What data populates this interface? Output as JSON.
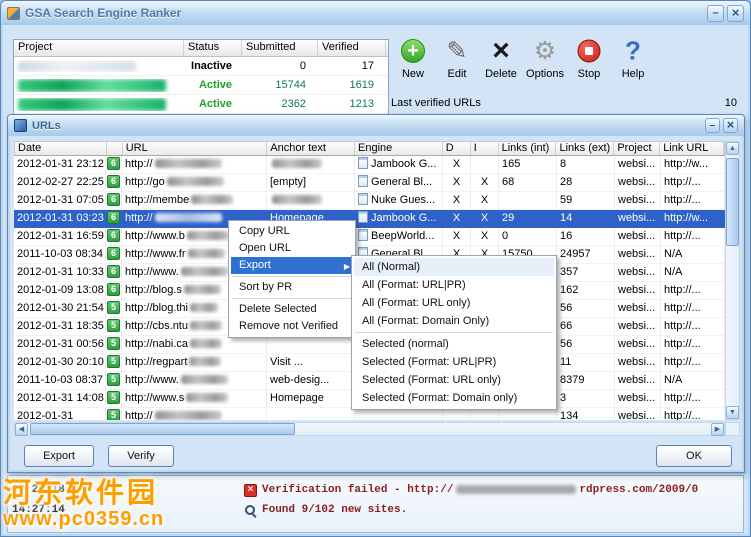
{
  "colors": {
    "selection": "#2e62c8",
    "menu_highlight": "#2f71d0",
    "active_status": "#1da321",
    "active_numbers": "#0c7a5a",
    "log_text": "#8b1e1e",
    "watermark_orange": "#ff9c00",
    "badge_green": "#2f9e44"
  },
  "main_window": {
    "title": "GSA Search Engine Ranker"
  },
  "projects_panel": {
    "columns": [
      "Project",
      "Status",
      "Submitted",
      "Verified"
    ],
    "rows": [
      {
        "status": "Inactive",
        "submitted": "0",
        "verified": "17",
        "active": false
      },
      {
        "status": "Active",
        "submitted": "15744",
        "verified": "1619",
        "active": true
      },
      {
        "status": "Active",
        "submitted": "2362",
        "verified": "1213",
        "active": true
      }
    ]
  },
  "toolbar": {
    "items": [
      {
        "label": "New",
        "icon": "new-icon"
      },
      {
        "label": "Edit",
        "icon": "edit-icon"
      },
      {
        "label": "Delete",
        "icon": "delete-icon"
      },
      {
        "label": "Options",
        "icon": "options-icon"
      },
      {
        "label": "Stop",
        "icon": "stop-icon"
      },
      {
        "label": "Help",
        "icon": "help-icon"
      }
    ],
    "last_verified_label": "Last verified URLs",
    "last_verified_value": "10"
  },
  "urls_window": {
    "title": "URLs",
    "columns": [
      "Date",
      "",
      "URL",
      "Anchor text",
      "Engine",
      "D",
      "I",
      "Links (int)",
      "Links (ext)",
      "Project",
      "Link URL"
    ],
    "export_button": "Export",
    "verify_button": "Verify",
    "ok_button": "OK",
    "rows": [
      {
        "date": "2012-01-31 23:12",
        "pr": "6",
        "url_prefix": "http://",
        "url_blur": true,
        "anchor": "",
        "anchor_blur": true,
        "engine": "Jambook G...",
        "d": "X",
        "i": "",
        "links_int": "165",
        "links_ext": "8",
        "project": "websi...",
        "link_url": "http://w...",
        "selected": false
      },
      {
        "date": "2012-02-27 22:25",
        "pr": "6",
        "url_prefix": "http://go",
        "url_blur": true,
        "anchor": "[empty]",
        "anchor_blur": false,
        "engine": "General Bl...",
        "d": "X",
        "i": "X",
        "links_int": "68",
        "links_ext": "28",
        "project": "websi...",
        "link_url": "http://...",
        "selected": false
      },
      {
        "date": "2012-01-31 07:05",
        "pr": "6",
        "url_prefix": "http://membe",
        "url_blur": true,
        "anchor": "",
        "anchor_blur": true,
        "engine": "Nuke Gues...",
        "d": "X",
        "i": "X",
        "links_int": "",
        "links_ext": "59",
        "project": "websi...",
        "link_url": "http://...",
        "selected": false
      },
      {
        "date": "2012-01-31 03:23",
        "pr": "6",
        "url_prefix": "http://",
        "url_blur": true,
        "anchor": "Homepage",
        "anchor_blur": false,
        "engine": "Jambook G...",
        "d": "X",
        "i": "X",
        "links_int": "29",
        "links_ext": "14",
        "project": "websi...",
        "link_url": "http://w...",
        "selected": true
      },
      {
        "date": "2012-01-31 16:59",
        "pr": "6",
        "url_prefix": "http://www.b",
        "url_blur": true,
        "anchor": "",
        "anchor_blur": false,
        "engine": "BeepWorld...",
        "d": "X",
        "i": "X",
        "links_int": "0",
        "links_ext": "16",
        "project": "websi...",
        "link_url": "http://...",
        "selected": false
      },
      {
        "date": "2011-10-03 08:34",
        "pr": "6",
        "url_prefix": "http://www.fr",
        "url_blur": true,
        "anchor": "",
        "anchor_blur": false,
        "engine": "General Bl...",
        "d": "X",
        "i": "X",
        "links_int": "15750",
        "links_ext": "24957",
        "project": "websi...",
        "link_url": "N/A",
        "selected": false
      },
      {
        "date": "2012-01-31 10:33",
        "pr": "6",
        "url_prefix": "http://www.",
        "url_blur": true,
        "anchor": "",
        "anchor_blur": false,
        "engine": "",
        "d": "",
        "i": "",
        "links_int": "",
        "links_ext": "357",
        "project": "websi...",
        "link_url": "N/A",
        "selected": false
      },
      {
        "date": "2012-01-09 13:08",
        "pr": "6",
        "url_prefix": "http://blog.s",
        "url_blur": true,
        "anchor": "",
        "anchor_blur": false,
        "engine": "",
        "d": "",
        "i": "",
        "links_int": "",
        "links_ext": "162",
        "project": "websi...",
        "link_url": "http://...",
        "selected": false
      },
      {
        "date": "2012-01-30 21:54",
        "pr": "5",
        "url_prefix": "http://blog.thi",
        "url_blur": true,
        "anchor": "",
        "anchor_blur": false,
        "engine": "",
        "d": "",
        "i": "",
        "links_int": "",
        "links_ext": "56",
        "project": "websi...",
        "link_url": "http://...",
        "selected": false
      },
      {
        "date": "2012-01-31 18:35",
        "pr": "5",
        "url_prefix": "http://cbs.ntu",
        "url_blur": true,
        "anchor": "",
        "anchor_blur": false,
        "engine": "",
        "d": "",
        "i": "",
        "links_int": "",
        "links_ext": "66",
        "project": "websi...",
        "link_url": "http://...",
        "selected": false
      },
      {
        "date": "2012-01-31 00:56",
        "pr": "5",
        "url_prefix": "http://nabi.ca",
        "url_blur": true,
        "anchor": "",
        "anchor_blur": false,
        "engine": "",
        "d": "",
        "i": "",
        "links_int": "",
        "links_ext": "56",
        "project": "websi...",
        "link_url": "http://...",
        "selected": false
      },
      {
        "date": "2012-01-30 20:10",
        "pr": "5",
        "url_prefix": "http://regpart",
        "url_blur": true,
        "anchor": "Visit ...",
        "anchor_blur": false,
        "engine": "",
        "d": "",
        "i": "",
        "links_int": "",
        "links_ext": "11",
        "project": "websi...",
        "link_url": "http://...",
        "selected": false
      },
      {
        "date": "2011-10-03 08:37",
        "pr": "5",
        "url_prefix": "http://www.",
        "url_blur": true,
        "anchor": "web-desig...",
        "anchor_blur": false,
        "engine": "",
        "d": "",
        "i": "",
        "links_int": "",
        "links_ext": "8379",
        "project": "websi...",
        "link_url": "N/A",
        "selected": false
      },
      {
        "date": "2012-01-31 14:08",
        "pr": "5",
        "url_prefix": "http://www.s",
        "url_blur": true,
        "anchor": "Homepage",
        "anchor_blur": false,
        "engine": "",
        "d": "",
        "i": "",
        "links_int": "",
        "links_ext": "3",
        "project": "websi...",
        "link_url": "http://...",
        "selected": false
      },
      {
        "date": "2012-01-31",
        "pr": "5",
        "url_prefix": "http://",
        "url_blur": true,
        "anchor": "",
        "anchor_blur": false,
        "engine": "",
        "d": "",
        "i": "",
        "links_int": "",
        "links_ext": "134",
        "project": "websi...",
        "link_url": "http://...",
        "selected": false
      }
    ]
  },
  "context_menu": {
    "items": [
      {
        "label": "Copy URL"
      },
      {
        "label": "Open URL"
      },
      {
        "label": "Export",
        "highlighted": true,
        "has_submenu": true
      },
      {
        "separator": true
      },
      {
        "label": "Sort by PR"
      },
      {
        "separator": true
      },
      {
        "label": "Delete Selected"
      },
      {
        "label": "Remove not Verified"
      }
    ]
  },
  "export_submenu": {
    "items": [
      {
        "label": "All (Normal)",
        "hover": true
      },
      {
        "label": "All (Format: URL|PR)"
      },
      {
        "label": "All (Format: URL only)"
      },
      {
        "label": "All (Format: Domain Only)"
      },
      {
        "separator": true
      },
      {
        "label": "Selected (normal)"
      },
      {
        "label": "Selected (Format: URL|PR)"
      },
      {
        "label": "Selected (Format: URL only)"
      },
      {
        "label": "Selected (Format: Domain only)"
      }
    ]
  },
  "log": {
    "lines": [
      {
        "time": "14:26:18",
        "icon": "error-icon",
        "prefix": "Verification failed - http://",
        "blur": true,
        "suffix": "rdpress.com/2009/0"
      },
      {
        "time": "14:27:14",
        "icon": "search-icon",
        "prefix": "Found 9/102 new sites.",
        "blur": false,
        "suffix": ""
      }
    ]
  },
  "watermark": {
    "line1": "河东软件园",
    "line2": "www.pc0359.cn"
  }
}
